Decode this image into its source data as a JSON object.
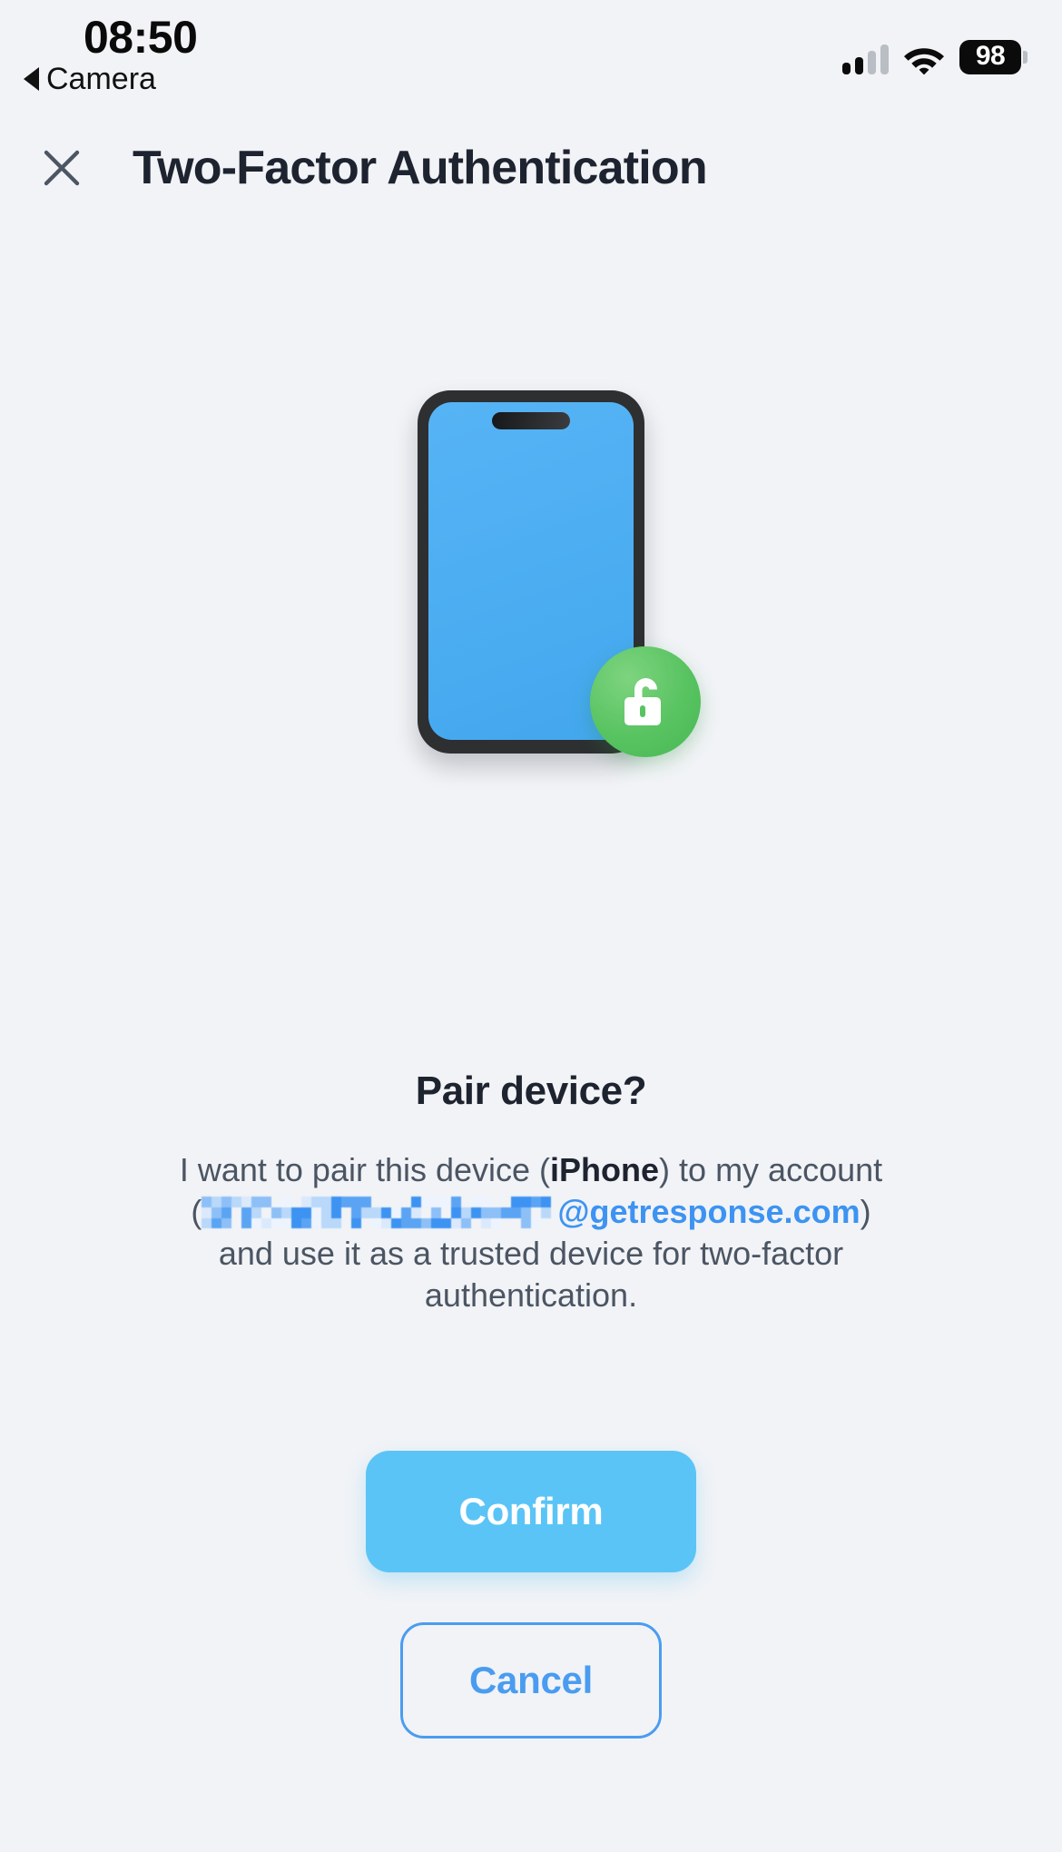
{
  "statusbar": {
    "time": "08:50",
    "back_label": "Camera",
    "back_icon": "back-triangle-icon",
    "signal_icon": "cellular-signal-icon",
    "signal_bars_total": 4,
    "signal_bars_active": 2,
    "wifi_icon": "wifi-icon",
    "battery_level": "98",
    "battery_icon": "battery-icon"
  },
  "appbar": {
    "close_icon": "close-icon",
    "title": "Two-Factor Authentication"
  },
  "illustration": {
    "device_icon": "smartphone-icon",
    "badge_icon": "unlock-padlock-icon",
    "screen_color": "#4BAEF2",
    "badge_color": "#58C361",
    "frame_color": "#2D2F31"
  },
  "content": {
    "heading": "Pair device?",
    "body_part1": "I want to pair this device (",
    "device_name": "iPhone",
    "body_part2": ") to my account",
    "email_open_paren": "(",
    "email_prefix_redacted": "",
    "email_domain": "@getresponse.com",
    "email_close_paren": ")",
    "body_part3": "and use it as a trusted device for two-factor authentication."
  },
  "actions": {
    "confirm_label": "Confirm",
    "cancel_label": "Cancel",
    "confirm_color": "#5BC4F6",
    "cancel_color": "#4A9CF0"
  }
}
